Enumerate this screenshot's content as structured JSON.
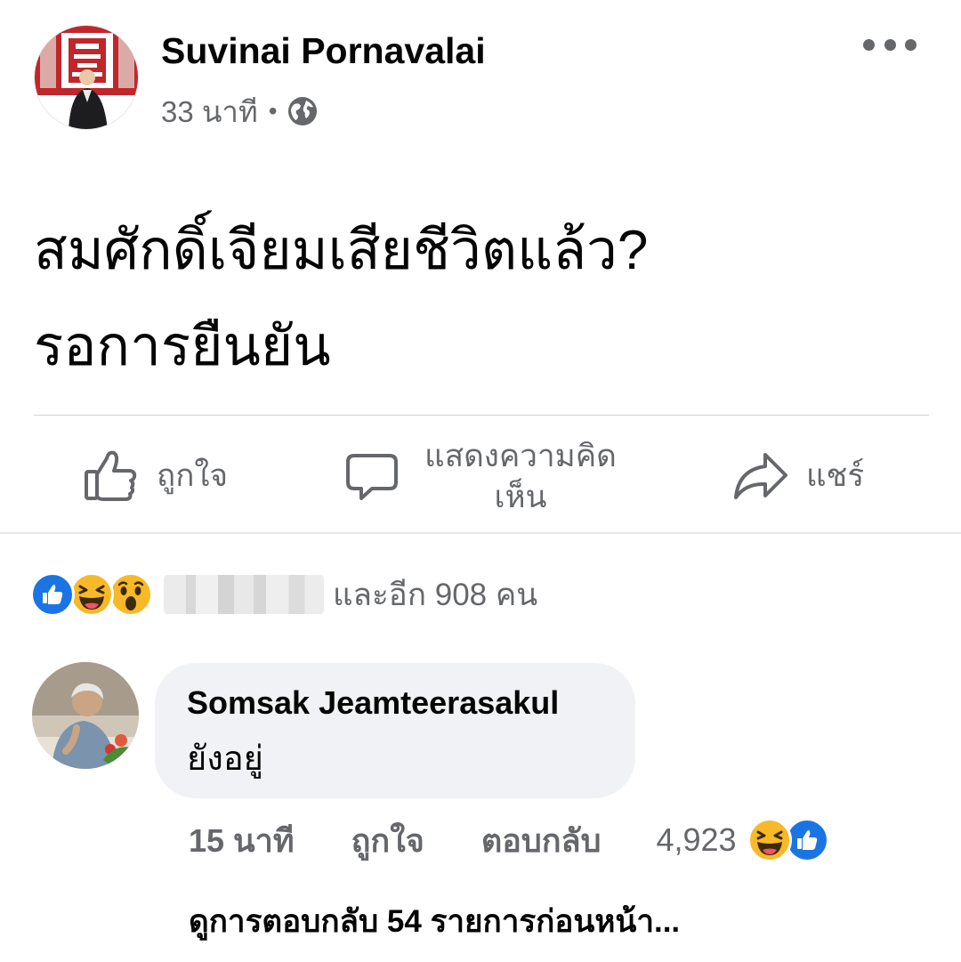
{
  "post": {
    "author": "Suvinai Pornavalai",
    "time": "33 นาที",
    "separator": "•",
    "privacy_icon": "globe-icon",
    "more_icon": "more-horizontal-icon",
    "text_lines": [
      "สมศักดิ์เจียมเสียชีวิตแล้ว?",
      "รอการยืนยัน"
    ]
  },
  "actions": {
    "like_label": "ถูกใจ",
    "comment_label_line1": "แสดงความคิด",
    "comment_label_line2": "เห็น",
    "share_label": "แชร์"
  },
  "reactions": {
    "icons": [
      "like-reaction-icon",
      "haha-reaction-icon",
      "wow-reaction-icon"
    ],
    "summary": "และอีก 908 คน"
  },
  "comment": {
    "author": "Somsak Jeamteerasakul",
    "text": "ยังอยู่",
    "time": "15 นาที",
    "like_label": "ถูกใจ",
    "reply_label": "ตอบกลับ",
    "reaction_count": "4,923",
    "reaction_icons": [
      "haha-reaction-icon",
      "like-reaction-icon"
    ]
  },
  "view_previous_replies": "ดูการตอบกลับ 54 รายการก่อนหน้า...",
  "colors": {
    "text_primary": "#050505",
    "text_secondary": "#65676b",
    "like_blue": "#1b74e4",
    "reaction_yellow": "#f7b928",
    "bubble_bg": "#f0f2f5",
    "divider": "#ced0d4"
  }
}
